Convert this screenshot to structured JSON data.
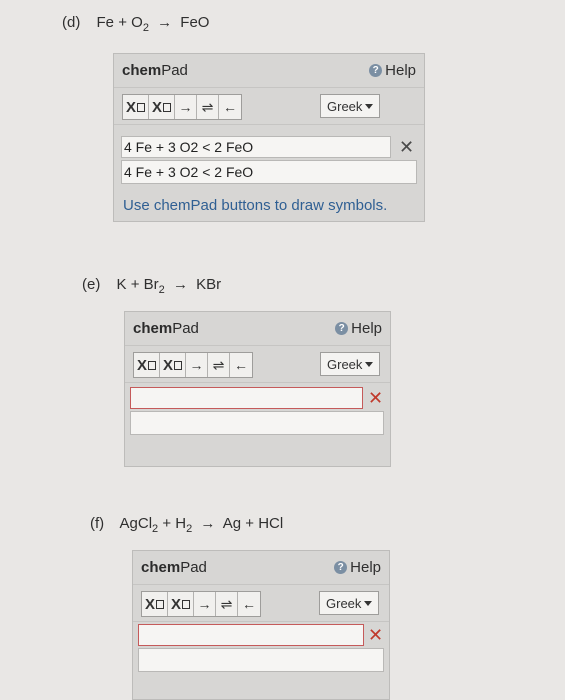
{
  "parts": [
    {
      "label": "(d)",
      "equation": {
        "r1": "Fe",
        "plus1": "+",
        "r2": "O",
        "r2_sub": "2",
        "arrow": "→",
        "p1": "FeO",
        "p1_sub": "",
        "plus2": "",
        "p2": ""
      },
      "input_value": "4 Fe + 3 O2 < 2 FeO",
      "preview_value": "4 Fe + 3 O2 < 2 FeO",
      "hint": "Use chemPad buttons to draw symbols."
    },
    {
      "label": "(e)",
      "equation": {
        "r1": "K",
        "plus1": "+",
        "r2": "Br",
        "r2_sub": "2",
        "arrow": "→",
        "p1": "KBr"
      },
      "input_value": "",
      "preview_value": ""
    },
    {
      "label": "(f)",
      "equation": {
        "r1": "AgCl",
        "r1_sub": "2",
        "plus1": "+",
        "r2": "H",
        "r2_sub": "2",
        "arrow": "→",
        "p1": "Ag",
        "plus2": "+",
        "p2": "HCl"
      },
      "input_value": "",
      "preview_value": ""
    }
  ],
  "chempad": {
    "title_bold": "chem",
    "title_rest": "Pad",
    "help_label": "Help",
    "help_icon": "?",
    "greek_label": "Greek",
    "buttons": {
      "subscript": "X",
      "superscript": "X",
      "arrow": "→",
      "equilibrium": "⇌",
      "left_arrow": "←"
    },
    "clear_glyph": "✕"
  }
}
